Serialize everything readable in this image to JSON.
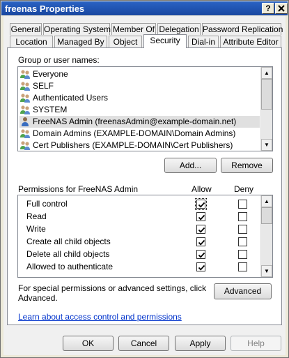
{
  "window": {
    "title": "freenas Properties",
    "help_btn": "?",
    "close_btn": "X"
  },
  "tabs_row1": [
    "General",
    "Operating System",
    "Member Of",
    "Delegation",
    "Password Replication"
  ],
  "tabs_row2": [
    "Location",
    "Managed By",
    "Object",
    "Security",
    "Dial-in",
    "Attribute Editor"
  ],
  "active_tab": "Security",
  "group_label": "Group or user names:",
  "users": [
    {
      "name": "Everyone"
    },
    {
      "name": "SELF"
    },
    {
      "name": "Authenticated Users"
    },
    {
      "name": "SYSTEM"
    },
    {
      "name": "FreeNAS Admin (freenasAdmin@example-domain.net)",
      "selected": true
    },
    {
      "name": "Domain Admins (EXAMPLE-DOMAIN\\Domain Admins)"
    },
    {
      "name": "Cert Publishers (EXAMPLE-DOMAIN\\Cert Publishers)"
    }
  ],
  "add_button": "Add...",
  "remove_button": "Remove",
  "permissions_label": "Permissions for FreeNAS Admin",
  "allow_header": "Allow",
  "deny_header": "Deny",
  "permissions": [
    {
      "name": "Full control",
      "allow": true,
      "deny": false
    },
    {
      "name": "Read",
      "allow": true,
      "deny": false
    },
    {
      "name": "Write",
      "allow": true,
      "deny": false
    },
    {
      "name": "Create all child objects",
      "allow": true,
      "deny": false
    },
    {
      "name": "Delete all child objects",
      "allow": true,
      "deny": false
    },
    {
      "name": "Allowed to authenticate",
      "allow": true,
      "deny": false
    }
  ],
  "special_text_line1": "For special permissions or advanced settings, click",
  "special_text_line2": "Advanced.",
  "advanced_button": "Advanced",
  "learn_link": "Learn about access control and permissions",
  "footer": {
    "ok": "OK",
    "cancel": "Cancel",
    "apply": "Apply",
    "help": "Help"
  },
  "colors": {
    "title_bar": "#1a4fa8",
    "link": "#0033cc",
    "selection": "#e0e0e0"
  }
}
